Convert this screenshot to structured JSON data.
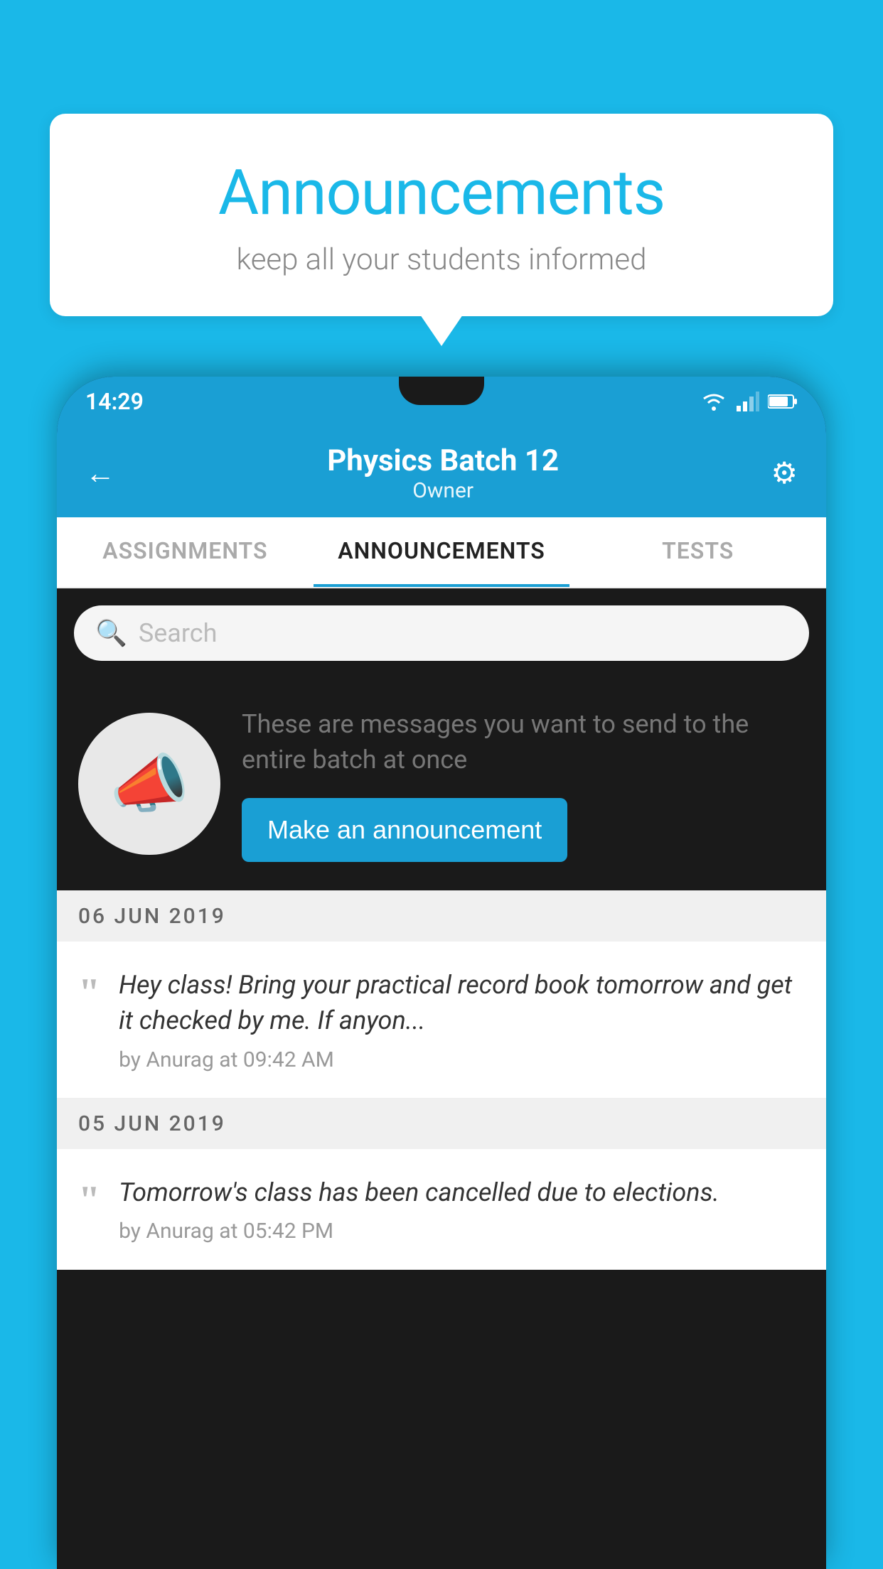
{
  "background_color": "#1ab8e8",
  "speech_bubble": {
    "title": "Announcements",
    "subtitle": "keep all your students informed"
  },
  "phone": {
    "status_bar": {
      "time": "14:29"
    },
    "header": {
      "title": "Physics Batch 12",
      "subtitle": "Owner",
      "back_label": "←",
      "gear_label": "⚙"
    },
    "tabs": [
      {
        "label": "ASSIGNMENTS",
        "active": false
      },
      {
        "label": "ANNOUNCEMENTS",
        "active": true
      },
      {
        "label": "TESTS",
        "active": false
      }
    ],
    "search": {
      "placeholder": "Search"
    },
    "promo": {
      "description": "These are messages you want to send to the entire batch at once",
      "button_label": "Make an announcement"
    },
    "announcements": [
      {
        "date": "06  JUN  2019",
        "text": "Hey class! Bring your practical record book tomorrow and get it checked by me. If anyon...",
        "meta": "by Anurag at 09:42 AM"
      },
      {
        "date": "05  JUN  2019",
        "text": "Tomorrow's class has been cancelled due to elections.",
        "meta": "by Anurag at 05:42 PM"
      }
    ]
  }
}
